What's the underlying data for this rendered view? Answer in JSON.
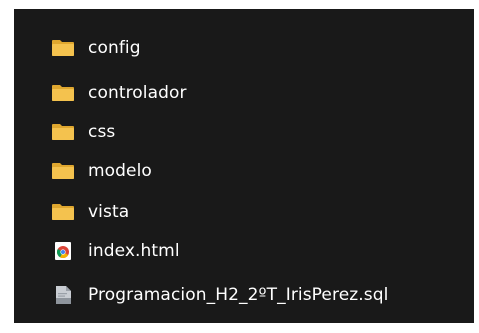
{
  "items": [
    {
      "name": "config",
      "type": "folder",
      "icon": "folder-icon"
    },
    {
      "name": "controlador",
      "type": "folder",
      "icon": "folder-icon"
    },
    {
      "name": "css",
      "type": "folder",
      "icon": "folder-icon"
    },
    {
      "name": "modelo",
      "type": "folder",
      "icon": "folder-icon"
    },
    {
      "name": "vista",
      "type": "folder",
      "icon": "folder-icon"
    },
    {
      "name": "index.html",
      "type": "html-file",
      "icon": "chrome-html-icon"
    },
    {
      "name": "Programacion_H2_2ºT_IrisPerez.sql",
      "type": "sql-file",
      "icon": "sql-file-icon"
    }
  ],
  "colors": {
    "background": "#191919",
    "text": "#ffffff",
    "folder": "#F2C14E"
  }
}
